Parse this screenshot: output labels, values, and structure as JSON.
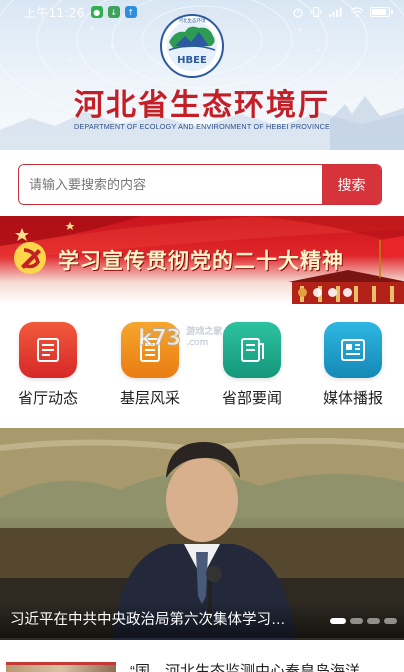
{
  "status_bar": {
    "time": "上午11:26",
    "icons": [
      "wechat-icon",
      "download-icon",
      "upload-icon"
    ],
    "right_icons": [
      "alarm-icon",
      "vibrate-icon",
      "signal-icon",
      "wifi-icon",
      "battery-icon"
    ],
    "battery_level": 0.9
  },
  "header": {
    "logo_text": "HBEE",
    "logo_ring_text": "河北生态环境",
    "title": "河北省生态环境厅",
    "subtitle": "DEPARTMENT OF ECOLOGY AND ENVIRONMENT OF HEBEI PROVINCE"
  },
  "search": {
    "placeholder": "请输入要搜索的内容",
    "value": "",
    "button_label": "搜索"
  },
  "banner": {
    "text": "学习宣传贯彻党的二十大精神",
    "icon": "party-emblem-icon",
    "slides": 4,
    "active_slide": 1
  },
  "quick_nav": [
    {
      "label": "省厅动态",
      "icon": "news-doc-icon",
      "color": "#e53a30"
    },
    {
      "label": "基层风采",
      "icon": "list-doc-icon",
      "color": "#f0901e"
    },
    {
      "label": "省部要闻",
      "icon": "article-doc-icon",
      "color": "#1fae8f"
    },
    {
      "label": "媒体播报",
      "icon": "newspaper-icon",
      "color": "#1b9fc9"
    }
  ],
  "watermark": {
    "text": "k73",
    "line1": "游戏之家",
    "line2": ".com"
  },
  "featured_news": {
    "caption": "习近平在中共中央政治局第六次集体学习…",
    "slides": 4,
    "active_slide": 0
  },
  "news_list": [
    {
      "title": "“国…河北生态监测中心秦皇岛海洋"
    }
  ],
  "colors": {
    "brand_red": "#c41f26",
    "search_button": "#d7333a",
    "subtitle_blue": "#2c4e8a"
  }
}
